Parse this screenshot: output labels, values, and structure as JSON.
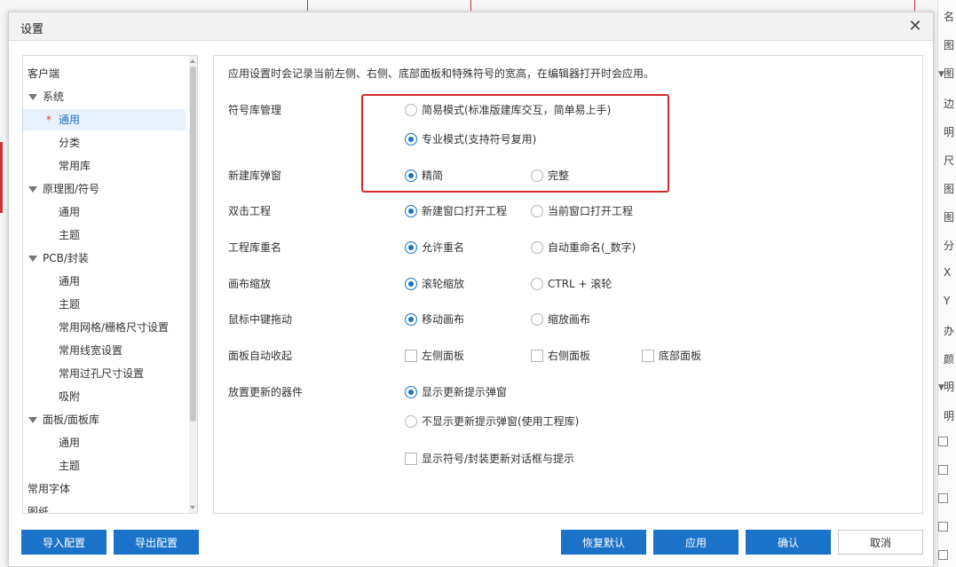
{
  "dialog": {
    "title": "设置",
    "close_glyph": "✕"
  },
  "background": {
    "right_items": [
      "名",
      "图",
      "图",
      "边",
      "明",
      "尺",
      "图",
      "图",
      "分",
      "X",
      "Y",
      "办",
      "颜",
      "明",
      "明"
    ]
  },
  "tree": {
    "items": [
      {
        "label": "客户端",
        "level": 0,
        "caret": false,
        "selected": false,
        "modified": false
      },
      {
        "label": "系统",
        "level": 0,
        "caret": true,
        "selected": false,
        "modified": false
      },
      {
        "label": "通用",
        "level": 1,
        "caret": false,
        "selected": true,
        "modified": true
      },
      {
        "label": "分类",
        "level": 1,
        "caret": false,
        "selected": false,
        "modified": false
      },
      {
        "label": "常用库",
        "level": 1,
        "caret": false,
        "selected": false,
        "modified": false
      },
      {
        "label": "原理图/符号",
        "level": 0,
        "caret": true,
        "selected": false,
        "modified": false
      },
      {
        "label": "通用",
        "level": 1,
        "caret": false,
        "selected": false,
        "modified": false
      },
      {
        "label": "主题",
        "level": 1,
        "caret": false,
        "selected": false,
        "modified": false
      },
      {
        "label": "PCB/封装",
        "level": 0,
        "caret": true,
        "selected": false,
        "modified": false
      },
      {
        "label": "通用",
        "level": 1,
        "caret": false,
        "selected": false,
        "modified": false
      },
      {
        "label": "主题",
        "level": 1,
        "caret": false,
        "selected": false,
        "modified": false
      },
      {
        "label": "常用网格/栅格尺寸设置",
        "level": 1,
        "caret": false,
        "selected": false,
        "modified": false
      },
      {
        "label": "常用线宽设置",
        "level": 1,
        "caret": false,
        "selected": false,
        "modified": false
      },
      {
        "label": "常用过孔尺寸设置",
        "level": 1,
        "caret": false,
        "selected": false,
        "modified": false
      },
      {
        "label": "吸附",
        "level": 1,
        "caret": false,
        "selected": false,
        "modified": false
      },
      {
        "label": "面板/面板库",
        "level": 0,
        "caret": true,
        "selected": false,
        "modified": false
      },
      {
        "label": "通用",
        "level": 1,
        "caret": false,
        "selected": false,
        "modified": false
      },
      {
        "label": "主题",
        "level": 1,
        "caret": false,
        "selected": false,
        "modified": false
      },
      {
        "label": "常用字体",
        "level": 0,
        "caret": false,
        "selected": false,
        "modified": false
      },
      {
        "label": "图纸",
        "level": 0,
        "caret": false,
        "selected": false,
        "modified": false
      }
    ],
    "modified_marker": "*"
  },
  "content": {
    "intro": "应用设置时会记录当前左侧、右侧、底部面板和特殊符号的宽高，在编辑器打开时会应用。",
    "sections": {
      "symbol_lib": {
        "label": "符号库管理",
        "options": [
          {
            "text": "简易模式(标准版建库交互，简单易上手)",
            "checked": false
          },
          {
            "text": "专业模式(支持符号复用)",
            "checked": true
          }
        ]
      },
      "new_lib_popup": {
        "label": "新建库弹窗",
        "options": [
          {
            "text": "精简",
            "checked": true
          },
          {
            "text": "完整",
            "checked": false
          }
        ]
      },
      "dblclick_project": {
        "label": "双击工程",
        "options": [
          {
            "text": "新建窗口打开工程",
            "checked": true
          },
          {
            "text": "当前窗口打开工程",
            "checked": false
          }
        ]
      },
      "project_lib_dup": {
        "label": "工程库重名",
        "options": [
          {
            "text": "允许重名",
            "checked": true
          },
          {
            "text": "自动重命名(_数字)",
            "checked": false
          }
        ]
      },
      "canvas_zoom": {
        "label": "画布缩放",
        "options": [
          {
            "text": "滚轮缩放",
            "checked": true
          },
          {
            "text": "CTRL + 滚轮",
            "checked": false
          }
        ]
      },
      "middle_drag": {
        "label": "鼠标中键拖动",
        "options": [
          {
            "text": "移动画布",
            "checked": true
          },
          {
            "text": "缩放画布",
            "checked": false
          }
        ]
      },
      "panel_autocollapse": {
        "label": "面板自动收起",
        "options": [
          {
            "text": "左侧面板",
            "checked": false
          },
          {
            "text": "右侧面板",
            "checked": false
          },
          {
            "text": "底部面板",
            "checked": false
          }
        ]
      },
      "placed_update": {
        "label": "放置更新的器件",
        "options": [
          {
            "text": "显示更新提示弹窗",
            "checked": true
          },
          {
            "text": "不显示更新提示弹窗(使用工程库)",
            "checked": false
          }
        ],
        "checkbox": {
          "text": "显示符号/封装更新对话框与提示",
          "checked": false
        }
      }
    }
  },
  "buttons": {
    "import": "导入配置",
    "export": "导出配置",
    "restore": "恢复默认",
    "apply": "应用",
    "ok": "确认",
    "cancel": "取消"
  },
  "colors": {
    "accent": "#1a73c8",
    "highlight": "#d62a2a"
  }
}
